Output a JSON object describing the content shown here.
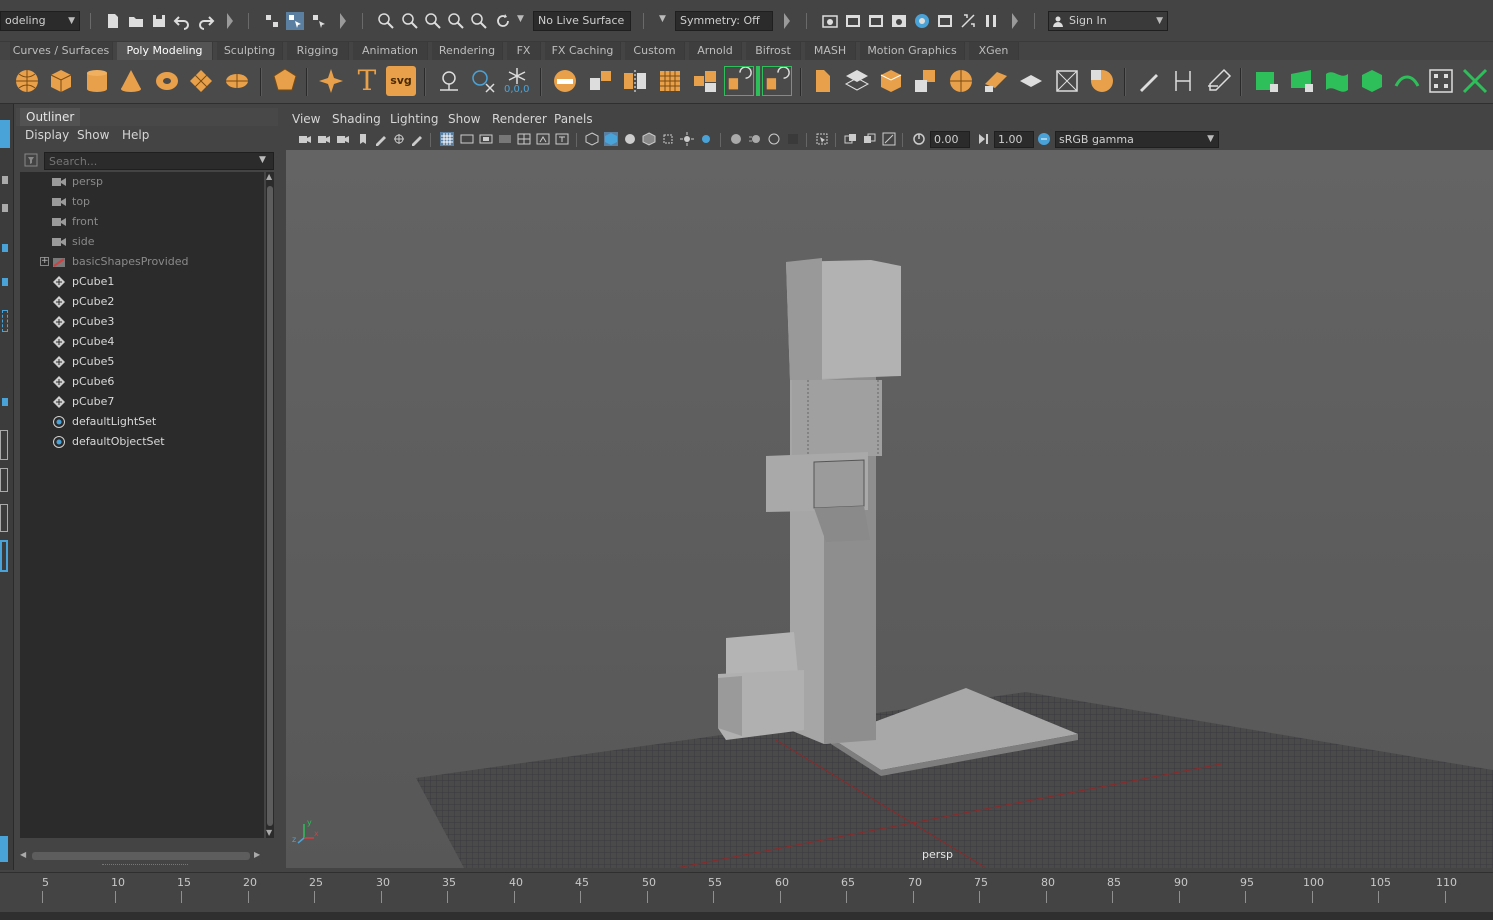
{
  "statusline": {
    "mode_menu": "odeling",
    "live_surface": "No Live Surface",
    "symmetry": "Symmetry: Off",
    "sign_in": "Sign In"
  },
  "shelf_tabs": [
    "Curves / Surfaces",
    "Poly Modeling",
    "Sculpting",
    "Rigging",
    "Animation",
    "Rendering",
    "FX",
    "FX Caching",
    "Custom",
    "Arnold",
    "Bifrost",
    "MASH",
    "Motion Graphics",
    "XGen"
  ],
  "shelf_active_tab": "Poly Modeling",
  "shelf": {
    "svg_label": "svg",
    "text_label": "T",
    "coords_label": "0,0,0"
  },
  "outliner": {
    "title": "Outliner",
    "menus": [
      "Display",
      "Show",
      "Help"
    ],
    "search_placeholder": "Search...",
    "items": [
      {
        "label": "persp",
        "type": "camera",
        "dim": true
      },
      {
        "label": "top",
        "type": "camera",
        "dim": true
      },
      {
        "label": "front",
        "type": "camera",
        "dim": true
      },
      {
        "label": "side",
        "type": "camera",
        "dim": true
      },
      {
        "label": "basicShapesProvided",
        "type": "group",
        "dim": true,
        "expandable": true
      },
      {
        "label": "pCube1",
        "type": "mesh"
      },
      {
        "label": "pCube2",
        "type": "mesh"
      },
      {
        "label": "pCube3",
        "type": "mesh"
      },
      {
        "label": "pCube4",
        "type": "mesh"
      },
      {
        "label": "pCube5",
        "type": "mesh"
      },
      {
        "label": "pCube6",
        "type": "mesh"
      },
      {
        "label": "pCube7",
        "type": "mesh"
      },
      {
        "label": "defaultLightSet",
        "type": "set"
      },
      {
        "label": "defaultObjectSet",
        "type": "set"
      }
    ]
  },
  "viewport": {
    "menus": [
      "View",
      "Shading",
      "Lighting",
      "Show",
      "Renderer",
      "Panels"
    ],
    "exposure": "0.00",
    "gamma": "1.00",
    "color_space": "sRGB gamma",
    "camera_label": "persp",
    "axis_y": "y",
    "axis_x": "x",
    "axis_z": "z"
  },
  "timeslider": {
    "ticks": [
      "5",
      "10",
      "15",
      "20",
      "25",
      "30",
      "35",
      "40",
      "45",
      "50",
      "55",
      "60",
      "65",
      "70",
      "75",
      "80",
      "85",
      "90",
      "95",
      "100",
      "105",
      "110"
    ]
  },
  "colors": {
    "accent_orange": "#e8a04a",
    "accent_blue": "#4aa3d8",
    "accent_green": "#2fbf5a",
    "grid_red": "#a03030"
  }
}
